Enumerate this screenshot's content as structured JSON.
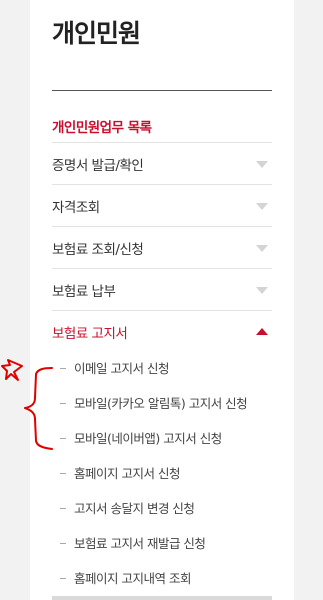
{
  "page": {
    "title": "개인민원"
  },
  "section": {
    "heading": "개인민원업무 목록"
  },
  "menu": {
    "items": [
      {
        "label": "증명서 발급/확인"
      },
      {
        "label": "자격조회"
      },
      {
        "label": "보험료 조회/신청"
      },
      {
        "label": "보험료 납부"
      },
      {
        "label": "보험료 고지서"
      }
    ]
  },
  "submenu": {
    "items": [
      {
        "label": "이메일 고지서 신청"
      },
      {
        "label": "모바일(카카오 알림톡) 고지서 신청"
      },
      {
        "label": "모바일(네이버앱) 고지서 신청"
      },
      {
        "label": "홈페이지 고지서 신청"
      },
      {
        "label": "고지서 송달지 변경 신청"
      },
      {
        "label": "보험료 고지서 재발급 신청"
      },
      {
        "label": "홈페이지 고지내역 조회"
      }
    ]
  },
  "colors": {
    "accent": "#c8102e",
    "annotation": "#e00000"
  }
}
